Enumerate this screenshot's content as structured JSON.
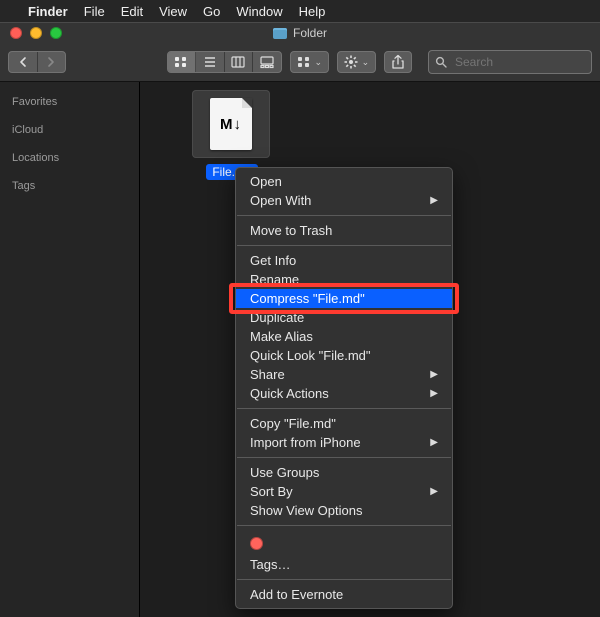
{
  "menubar": {
    "app": "Finder",
    "items": [
      "File",
      "Edit",
      "View",
      "Go",
      "Window",
      "Help"
    ]
  },
  "window": {
    "title": "Folder"
  },
  "toolbar": {
    "search_placeholder": "Search"
  },
  "sidebar": {
    "sections": [
      "Favorites",
      "iCloud",
      "Locations",
      "Tags"
    ]
  },
  "file": {
    "name": "File.md",
    "glyph": "M↓"
  },
  "context_menu": {
    "groups": [
      [
        {
          "label": "Open",
          "submenu": false
        },
        {
          "label": "Open With",
          "submenu": true
        }
      ],
      [
        {
          "label": "Move to Trash",
          "submenu": false
        }
      ],
      [
        {
          "label": "Get Info",
          "submenu": false
        },
        {
          "label": "Rename",
          "submenu": false
        },
        {
          "label": "Compress \"File.md\"",
          "submenu": false,
          "selected": true,
          "highlighted": true
        },
        {
          "label": "Duplicate",
          "submenu": false
        },
        {
          "label": "Make Alias",
          "submenu": false
        },
        {
          "label": "Quick Look \"File.md\"",
          "submenu": false
        },
        {
          "label": "Share",
          "submenu": true
        },
        {
          "label": "Quick Actions",
          "submenu": true
        }
      ],
      [
        {
          "label": "Copy \"File.md\"",
          "submenu": false
        },
        {
          "label": "Import from iPhone",
          "submenu": true
        }
      ],
      [
        {
          "label": "Use Groups",
          "submenu": false
        },
        {
          "label": "Sort By",
          "submenu": true
        },
        {
          "label": "Show View Options",
          "submenu": false
        }
      ],
      [
        {
          "tag_row": true
        },
        {
          "label": "Tags…",
          "submenu": false
        }
      ],
      [
        {
          "label": "Add to Evernote",
          "submenu": false
        }
      ]
    ]
  }
}
